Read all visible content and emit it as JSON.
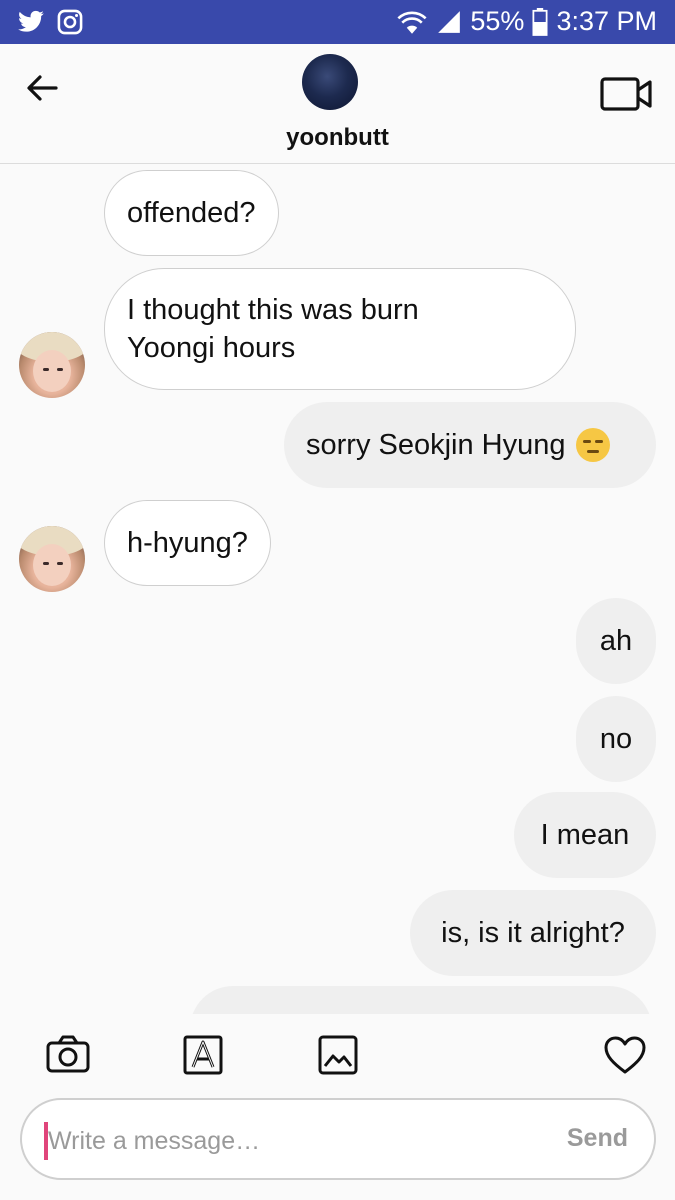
{
  "status_bar": {
    "battery": "55%",
    "time": "3:37 PM",
    "left_icons": [
      "twitter-icon",
      "instagram-icon"
    ],
    "right_icons": [
      "wifi-icon",
      "signal-icon",
      "battery-icon"
    ]
  },
  "header": {
    "username": "yoonbutt",
    "back_icon": "arrow-left-icon",
    "video_icon": "video-camera-icon"
  },
  "messages": [
    {
      "side": "in",
      "text": "offended?",
      "avatar": false
    },
    {
      "side": "in",
      "lines": [
        "I thought this was burn",
        "Yoongi hours"
      ],
      "avatar": true
    },
    {
      "side": "out",
      "text": "sorry Seokjin Hyung",
      "emoji": "pensive-face-emoji"
    },
    {
      "side": "in",
      "text": "h-hyung?",
      "avatar": true
    },
    {
      "side": "out",
      "text": "ah"
    },
    {
      "side": "out",
      "text": "no"
    },
    {
      "side": "out",
      "text": "I mean"
    },
    {
      "side": "out",
      "text": "is, is it alright?"
    }
  ],
  "toolbar": {
    "icons": [
      "camera-icon",
      "text-format-icon",
      "gallery-icon",
      "heart-icon"
    ]
  },
  "composer": {
    "placeholder": "Write a message…",
    "value": "",
    "send_label": "Send"
  },
  "colors": {
    "status_bar_bg": "#3949ab",
    "incoming_bubble_bg": "#ffffff",
    "outgoing_bubble_bg": "#efefef",
    "caret": "#e0457b"
  }
}
